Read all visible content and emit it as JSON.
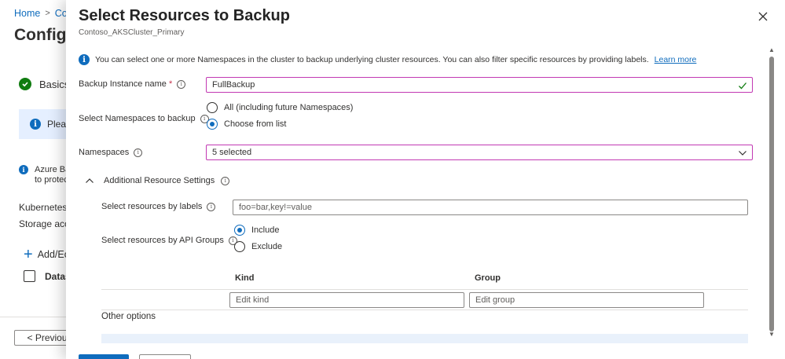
{
  "background": {
    "breadcrumb": [
      "Home",
      "Con"
    ],
    "title": "Configu",
    "step_label": "Basics",
    "info_text": "Please",
    "note_line1": "Azure Bac",
    "note_line2": "to protec",
    "kubernetes_label": "Kubernetes s",
    "storage_label": "Storage acco",
    "add_label": "Add/Ec",
    "data_column": "Datas",
    "previous_button": "< Previous"
  },
  "panel": {
    "title": "Select Resources to Backup",
    "subtitle": "Contoso_AKSCluster_Primary",
    "info_text": "You can select one or more Namespaces in the cluster to backup underlying cluster resources. You can also filter specific resources by providing labels.",
    "learn_more": "Learn more",
    "backup_instance": {
      "label": "Backup Instance name",
      "required_mark": "*",
      "value": "FullBackup"
    },
    "namespaces_to_backup": {
      "label": "Select Namespaces to backup",
      "options": [
        "All (including future Namespaces)",
        "Choose from list"
      ],
      "selected": "Choose from list"
    },
    "namespaces": {
      "label": "Namespaces",
      "value": "5 selected"
    },
    "additional_settings": {
      "label": "Additional Resource Settings",
      "labels_field": {
        "label": "Select resources by labels",
        "placeholder": "foo=bar,key!=value"
      },
      "api_groups": {
        "label": "Select resources by API Groups",
        "options": [
          "Include",
          "Exclude"
        ],
        "selected": "Include"
      },
      "table": {
        "columns": [
          "Kind",
          "Group"
        ],
        "kind_placeholder": "Edit kind",
        "group_placeholder": "Edit group"
      }
    },
    "other_options": "Other options"
  },
  "colors": {
    "accent": "#0f6cbd",
    "valid_border": "#c239b3",
    "success": "#107c10"
  }
}
